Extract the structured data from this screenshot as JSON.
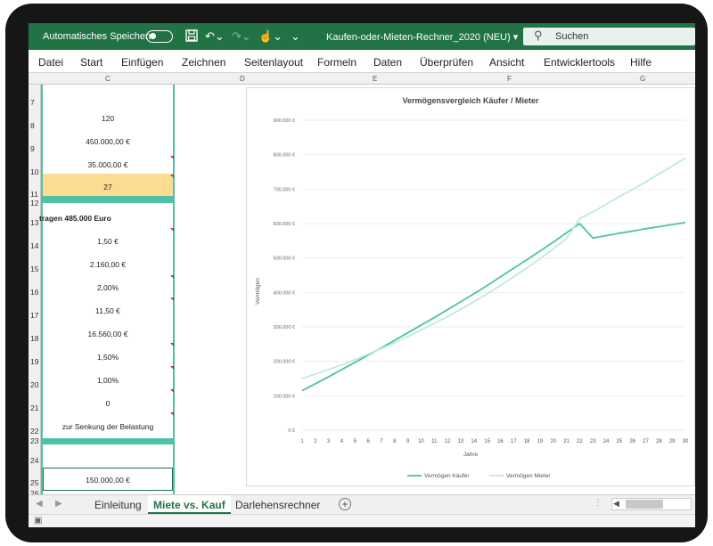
{
  "titlebar": {
    "autosave_label": "Automatisches Speichern",
    "document_title": "Kaufen-oder-Mieten-Rechner_2020 (NEU) ▾",
    "search_label": "Suchen"
  },
  "menu": [
    "Datei",
    "Start",
    "Einfügen",
    "Zeichnen",
    "Seitenlayout",
    "Formeln",
    "Daten",
    "Überprüfen",
    "Ansicht",
    "Entwicklertools",
    "Hilfe"
  ],
  "columns": [
    "C",
    "D",
    "E",
    "F",
    "G"
  ],
  "rows": [
    "7",
    "8",
    "9",
    "10",
    "11",
    "12",
    "13",
    "14",
    "15",
    "16",
    "17",
    "18",
    "19",
    "20",
    "21",
    "22",
    "23",
    "24",
    "25",
    "26"
  ],
  "cells": {
    "r8": "120",
    "r9": "450.000,00 €",
    "r10": "35.000,00 €",
    "r11": "27",
    "r13": "tragen 485.000 Euro",
    "r14": "1,50 €",
    "r15": "2.160,00 €",
    "r16": "2,00%",
    "r17": "11,50 €",
    "r18": "16.560,00 €",
    "r19": "1,50%",
    "r20": "1,00%",
    "r21": "0",
    "r22": "zur Senkung der Belastung",
    "r25": "150.000,00 €"
  },
  "colors": {
    "excel_green": "#217346",
    "teal": "#4fc1a6",
    "highlight": "#fbdc92",
    "series_kaeufer": "#4fc1a6",
    "series_mieter": "#bfeadf"
  },
  "sheet_tabs": [
    "Einleitung",
    "Miete vs. Kauf",
    "Darlehensrechner"
  ],
  "active_tab": "Miete vs. Kauf",
  "chart_data": {
    "type": "line",
    "title": "Vermögensvergleich Käufer / Mieter",
    "xlabel": "Jahre",
    "ylabel": "Vermögen",
    "ylim": [
      0,
      900000
    ],
    "y_ticks": [
      0,
      100000,
      200000,
      300000,
      400000,
      500000,
      600000,
      700000,
      800000,
      900000
    ],
    "y_tick_labels": [
      "0 €",
      "100.000 €",
      "200.000 €",
      "300.000 €",
      "400.000 €",
      "500.000 €",
      "600.000 €",
      "700.000 €",
      "800.000 €",
      "900.000 €"
    ],
    "x": [
      1,
      2,
      3,
      4,
      5,
      6,
      7,
      8,
      9,
      10,
      11,
      12,
      13,
      14,
      15,
      16,
      17,
      18,
      19,
      20,
      21,
      22,
      23,
      24,
      25,
      26,
      27,
      28,
      29,
      30
    ],
    "legend_position": "bottom",
    "grid": "horizontal",
    "series": [
      {
        "name": "Vermögen Käufer",
        "color": "#4fc1a6",
        "values": [
          115000,
          135000,
          155000,
          176000,
          197000,
          218000,
          239000,
          261000,
          283000,
          305000,
          327000,
          350000,
          373000,
          396000,
          420000,
          445000,
          470000,
          495000,
          520000,
          546000,
          573000,
          600000,
          558000,
          565000,
          572000,
          578000,
          585000,
          591000,
          597000,
          603000
        ]
      },
      {
        "name": "Vermögen Mieter",
        "color": "#bfeadf",
        "values": [
          150000,
          163000,
          176000,
          190000,
          205000,
          221000,
          237000,
          254000,
          272000,
          291000,
          310000,
          330000,
          351000,
          373000,
          396000,
          420000,
          445000,
          471000,
          498000,
          526000,
          556000,
          614000,
          634000,
          656000,
          678000,
          699000,
          721000,
          744000,
          767000,
          790000
        ]
      }
    ]
  }
}
